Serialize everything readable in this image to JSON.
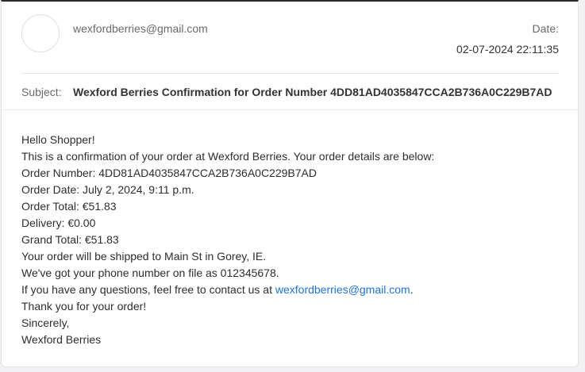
{
  "email": {
    "from": "wexfordberries@gmail.com",
    "date_label": "Date:",
    "date_value": "02-07-2024 22:11:35",
    "subject_label": "Subject:",
    "subject_value": "Wexford Berries Confirmation for Order Number 4DD81AD4035847CCA2B736A0C229B7AD"
  },
  "body": {
    "greeting": "Hello Shopper!",
    "intro": "This is a confirmation of your order at Wexford Berries. Your order details are below:",
    "order_number": "Order Number: 4DD81AD4035847CCA2B736A0C229B7AD",
    "order_date": "Order Date: July 2, 2024, 9:11 p.m.",
    "order_total": "Order Total: €51.83",
    "delivery": "Delivery: €0.00",
    "grand_total": "Grand Total: €51.83",
    "shipping": "Your order will be shipped to Main St in Gorey, IE.",
    "phone": "We've got your phone number on file as 012345678.",
    "contact_prefix": "If you have any questions, feel free to contact us at ",
    "contact_link": "wexfordberries@gmail.com",
    "contact_suffix": ".",
    "thanks": "Thank you for your order!",
    "sincerely": "Sincerely,",
    "signature": "Wexford Berries"
  }
}
